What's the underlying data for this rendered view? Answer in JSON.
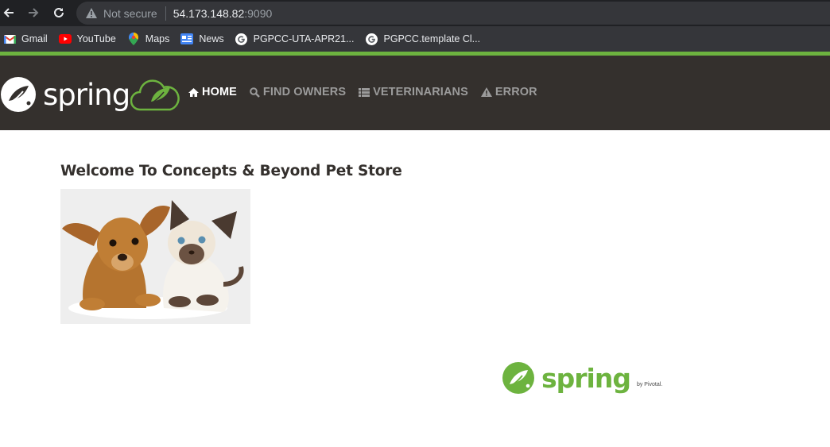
{
  "browser": {
    "security_label": "Not secure",
    "host": "54.173.148.82",
    "port": ":9090"
  },
  "bookmarks": [
    {
      "label": "Gmail",
      "icon": "gmail-icon"
    },
    {
      "label": "YouTube",
      "icon": "youtube-icon"
    },
    {
      "label": "Maps",
      "icon": "maps-icon"
    },
    {
      "label": "News",
      "icon": "news-icon"
    },
    {
      "label": "PGPCC-UTA-APR21...",
      "icon": "google-icon"
    },
    {
      "label": "PGPCC.template Cl...",
      "icon": "google-icon"
    }
  ],
  "navbar": {
    "brand": "spring",
    "items": [
      {
        "label": "HOME",
        "icon": "home-icon",
        "active": true
      },
      {
        "label": "FIND OWNERS",
        "icon": "search-icon",
        "active": false
      },
      {
        "label": "VETERINARIANS",
        "icon": "list-icon",
        "active": false
      },
      {
        "label": "ERROR",
        "icon": "warning-icon",
        "active": false
      }
    ]
  },
  "main": {
    "title": "Welcome To Concepts & Beyond Pet Store"
  },
  "footer": {
    "brand": "spring",
    "byline": "by Pivotal."
  },
  "colors": {
    "spring_green": "#6db33f",
    "navbar_bg": "#34302d",
    "chrome_bg": "#202124"
  }
}
